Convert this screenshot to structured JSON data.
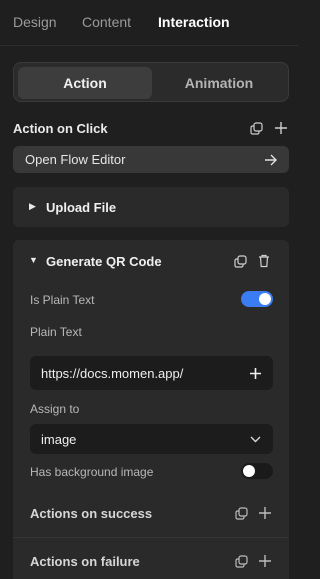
{
  "tabs": [
    {
      "label": "Design",
      "active": false
    },
    {
      "label": "Content",
      "active": false
    },
    {
      "label": "Interaction",
      "active": true
    }
  ],
  "segment": {
    "action_label": "Action",
    "animation_label": "Animation",
    "selected": "Action"
  },
  "action_on_click": {
    "title": "Action on Click",
    "copy_icon": "copy-icon",
    "add_icon": "plus-icon",
    "flow_button_label": "Open Flow Editor",
    "flow_button_icon": "arrow-right-icon"
  },
  "actions": [
    {
      "title": "Upload File",
      "expanded": false
    },
    {
      "title": "Generate QR Code",
      "expanded": true,
      "is_plain_text_label": "Is Plain Text",
      "is_plain_text": true,
      "plain_text_label": "Plain Text",
      "plain_text_value": "https://docs.momen.app/",
      "assign_to_label": "Assign to",
      "assign_to_value": "image",
      "has_background_label": "Has background image",
      "has_background": false,
      "on_success_label": "Actions on success",
      "on_failure_label": "Actions on failure"
    }
  ],
  "colors": {
    "accent": "#3b7cf2",
    "background": "#1f1f1f",
    "card": "#2a2a2a"
  }
}
